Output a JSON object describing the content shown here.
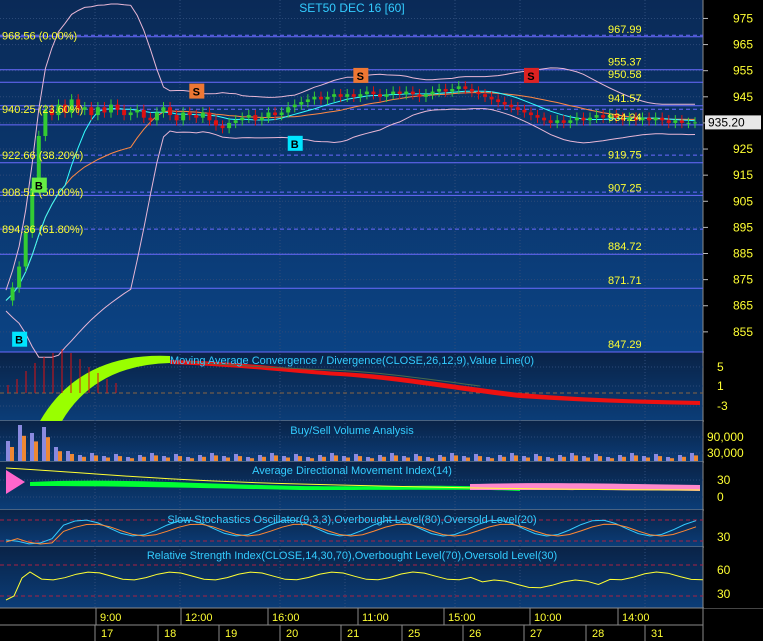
{
  "colors": {
    "panel_top": "#0a2a57",
    "panel_bottom": "#0a3d77",
    "label_yellow": "#ffff33",
    "label_cyan": "#33ccff",
    "price_line_white": "#d8d8d8",
    "fib_line": "#6a6aff",
    "bollinger": "#e8b7d6",
    "candle_green": "#33cc33",
    "candle_red": "#dd1111",
    "macd_green": "#99ff00",
    "macd_red": "#ee1111",
    "sell_signal": "#ee7733",
    "sell_signal_alt": "#dd2222",
    "buy_signal": "#00e5ff",
    "buy_signal_alt": "#66ee44"
  },
  "chart_data": [
    {
      "type": "line",
      "title": "SET50 DEC 16   [60]",
      "y_ticks": [
        975,
        965,
        955,
        945,
        935,
        925,
        915,
        905,
        895,
        885,
        875,
        865,
        855
      ],
      "last_price_label": "935.20",
      "last_price": 935.2,
      "fib_levels_left": [
        {
          "label": "968.56 (0.00%)",
          "value": 968.56
        },
        {
          "label": "940.25 (23.60%)",
          "value": 940.25
        },
        {
          "label": "922.66 (38.20%)",
          "value": 922.66
        },
        {
          "label": "908.51 (50.00%)",
          "value": 908.51
        },
        {
          "label": "894.36 (61.80%)",
          "value": 894.36
        }
      ],
      "price_levels_right": [
        {
          "label": "967.99",
          "value": 967.99
        },
        {
          "label": "955.37",
          "value": 955.37
        },
        {
          "label": "950.58",
          "value": 950.58
        },
        {
          "label": "941.57",
          "value": 941.57
        },
        {
          "label": "934.24",
          "value": 934.24
        },
        {
          "label": "919.75",
          "value": 919.75
        },
        {
          "label": "907.25",
          "value": 907.25
        },
        {
          "label": "884.72",
          "value": 884.72
        },
        {
          "label": "871.71",
          "value": 871.71
        },
        {
          "label": "847.29",
          "value": 847.29
        }
      ],
      "signals": [
        {
          "label": "B",
          "kind": "buy",
          "bar": 2,
          "value": 852
        },
        {
          "label": "B",
          "kind": "buy",
          "bar": 5,
          "value": 911
        },
        {
          "label": "S",
          "kind": "sell",
          "bar": 29,
          "value": 947
        },
        {
          "label": "B",
          "kind": "buy",
          "bar": 44,
          "value": 927
        },
        {
          "label": "S",
          "kind": "sell",
          "bar": 54,
          "value": 953
        },
        {
          "label": "S",
          "kind": "sell_alt",
          "bar": 80,
          "value": 953
        }
      ],
      "close": [
        867,
        872,
        880,
        893,
        910,
        930,
        940,
        938,
        942,
        939,
        944,
        940,
        941,
        938,
        941,
        939,
        942,
        940,
        938,
        939,
        940,
        937,
        936,
        939,
        941,
        938,
        936,
        939,
        938,
        937,
        939,
        936,
        934,
        933,
        935,
        936,
        937,
        938,
        936,
        937,
        939,
        938,
        939,
        941,
        942,
        943,
        944,
        945,
        944,
        945,
        946,
        945,
        946,
        945,
        946,
        947,
        946,
        945,
        946,
        947,
        946,
        947,
        946,
        945,
        946,
        947,
        948,
        947,
        948,
        949,
        948,
        947,
        946,
        945,
        944,
        943,
        942,
        941,
        940,
        939,
        938,
        937,
        936,
        935,
        936,
        935,
        936,
        937,
        936,
        937,
        938,
        937,
        938,
        937,
        936,
        937,
        936,
        937,
        936,
        937,
        936,
        935,
        936,
        935,
        935,
        935.2
      ]
    },
    {
      "type": "bar",
      "title": "Moving Average Convergence / Divergence(CLOSE,26,12,9),Value Line(0)",
      "y_ticks": [
        5,
        1,
        -3
      ]
    },
    {
      "type": "bar",
      "title": "Buy/Sell Volume Analysis",
      "y_ticks": [
        "90,000",
        "30,000"
      ]
    },
    {
      "type": "area",
      "title": "Average Directional Movement Index(14)",
      "y_ticks": [
        30,
        0
      ]
    },
    {
      "type": "line",
      "title": "Slow Stochastics Oscillator(9,3,3),Overbought Level(80),Oversold Level(20)",
      "y_ticks": [
        30
      ]
    },
    {
      "type": "line",
      "title": "Relative Strength Index(CLOSE,14,30,70),Overbought Level(70),Oversold Level(30)",
      "y_ticks": [
        60,
        30
      ]
    }
  ],
  "time_axis": {
    "hours": [
      "9:00",
      "12:00",
      "16:00",
      "11:00",
      "15:00",
      "10:00",
      "14:00"
    ],
    "days": [
      "17",
      "18",
      "19",
      "20",
      "21",
      "25",
      "26",
      "27",
      "28",
      "31"
    ]
  }
}
